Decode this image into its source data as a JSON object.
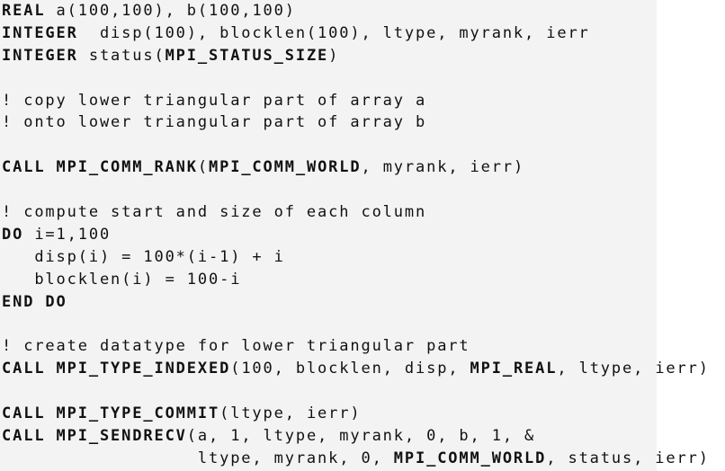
{
  "code": {
    "language": "Fortran",
    "lines": [
      [
        {
          "t": "REAL",
          "kw": true
        },
        {
          "t": " a(100,100), b(100,100)"
        }
      ],
      [
        {
          "t": "INTEGER",
          "kw": true
        },
        {
          "t": "  disp(100), blocklen(100), ltype, myrank, ierr"
        }
      ],
      [
        {
          "t": "INTEGER",
          "kw": true
        },
        {
          "t": " status("
        },
        {
          "t": "MPI_STATUS_SIZE",
          "kw": true
        },
        {
          "t": ")"
        }
      ],
      [],
      [
        {
          "t": "! copy lower triangular part of array a"
        }
      ],
      [
        {
          "t": "! onto lower triangular part of array b"
        }
      ],
      [],
      [
        {
          "t": "CALL",
          "kw": true
        },
        {
          "t": " "
        },
        {
          "t": "MPI_COMM_RANK",
          "kw": true
        },
        {
          "t": "("
        },
        {
          "t": "MPI_COMM_WORLD",
          "kw": true
        },
        {
          "t": ", myrank, ierr)"
        }
      ],
      [],
      [
        {
          "t": "! compute start and size of each column"
        }
      ],
      [
        {
          "t": "DO",
          "kw": true
        },
        {
          "t": " i=1,100"
        }
      ],
      [
        {
          "t": "   disp(i) = 100*(i-1) + i"
        }
      ],
      [
        {
          "t": "   blocklen(i) = 100-i"
        }
      ],
      [
        {
          "t": "END DO",
          "kw": true
        }
      ],
      [],
      [
        {
          "t": "! create datatype for lower triangular part"
        }
      ],
      [
        {
          "t": "CALL",
          "kw": true
        },
        {
          "t": " "
        },
        {
          "t": "MPI_TYPE_INDEXED",
          "kw": true
        },
        {
          "t": "(100, blocklen, disp, "
        },
        {
          "t": "MPI_REAL",
          "kw": true
        },
        {
          "t": ", ltype, ierr)"
        }
      ],
      [],
      [
        {
          "t": "CALL",
          "kw": true
        },
        {
          "t": " "
        },
        {
          "t": "MPI_TYPE_COMMIT",
          "kw": true
        },
        {
          "t": "(ltype, ierr)"
        }
      ],
      [
        {
          "t": "CALL",
          "kw": true
        },
        {
          "t": " "
        },
        {
          "t": "MPI_SENDRECV",
          "kw": true
        },
        {
          "t": "(a, 1, ltype, myrank, 0, b, 1, &"
        }
      ],
      [
        {
          "t": "                  ltype, myrank, 0, "
        },
        {
          "t": "MPI_COMM_WORLD",
          "kw": true
        },
        {
          "t": ", status, ierr)"
        }
      ]
    ]
  }
}
